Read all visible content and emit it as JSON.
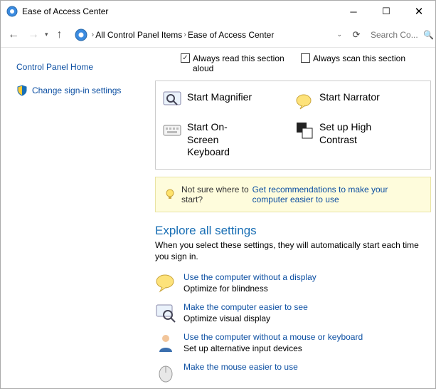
{
  "window": {
    "title": "Ease of Access Center"
  },
  "breadcrumb": {
    "item1": "All Control Panel Items",
    "item2": "Ease of Access Center"
  },
  "search": {
    "placeholder": "Search Co..."
  },
  "leftnav": {
    "home": "Control Panel Home",
    "signin": "Change sign-in settings"
  },
  "checks": {
    "read": "Always read this section aloud",
    "scan": "Always scan this section"
  },
  "tools": {
    "magnifier": "Start Magnifier",
    "narrator": "Start Narrator",
    "osk": "Start On-Screen Keyboard",
    "contrast": "Set up High Contrast"
  },
  "hint": {
    "q": "Not sure where to start?",
    "a": "Get recommendations to make your computer easier to use"
  },
  "explore": {
    "heading": "Explore all settings",
    "sub": "When you select these settings, they will automatically start each time you sign in."
  },
  "cats": [
    {
      "link": "Use the computer without a display",
      "desc": "Optimize for blindness"
    },
    {
      "link": "Make the computer easier to see",
      "desc": "Optimize visual display"
    },
    {
      "link": "Use the computer without a mouse or keyboard",
      "desc": "Set up alternative input devices"
    },
    {
      "link": "Make the mouse easier to use",
      "desc": ""
    }
  ]
}
